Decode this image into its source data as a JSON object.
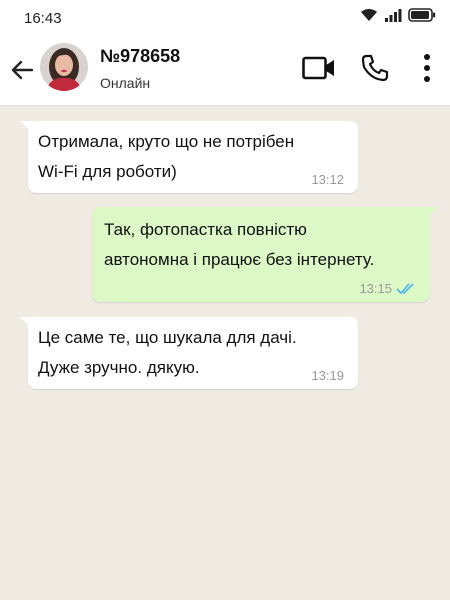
{
  "status_bar": {
    "time": "16:43",
    "icons": [
      "wifi-icon",
      "signal-icon",
      "battery-icon"
    ]
  },
  "header": {
    "contact_name": "№978658",
    "contact_status": "Онлайн",
    "actions": [
      "back-arrow-icon",
      "video-call-icon",
      "phone-icon",
      "more-vert-icon"
    ]
  },
  "messages": [
    {
      "direction": "incoming",
      "text": " Отримала, круто що не потрібен\nWi-Fi для роботи)",
      "time": "13:12"
    },
    {
      "direction": "outgoing",
      "text": " Так, фотопастка повністю\nавтономна і працює без інтернету.",
      "time": "13:15",
      "read_receipt": "double-check-icon"
    },
    {
      "direction": "incoming",
      "text": " Це саме те, що шукала для дачі.\nДуже зручно. дякую.",
      "time": "13:19"
    }
  ],
  "colors": {
    "chat_background": "#efeae2",
    "incoming_bubble": "#ffffff",
    "outgoing_bubble": "#dcf8c6",
    "read_receipt": "#4fb6ec"
  }
}
